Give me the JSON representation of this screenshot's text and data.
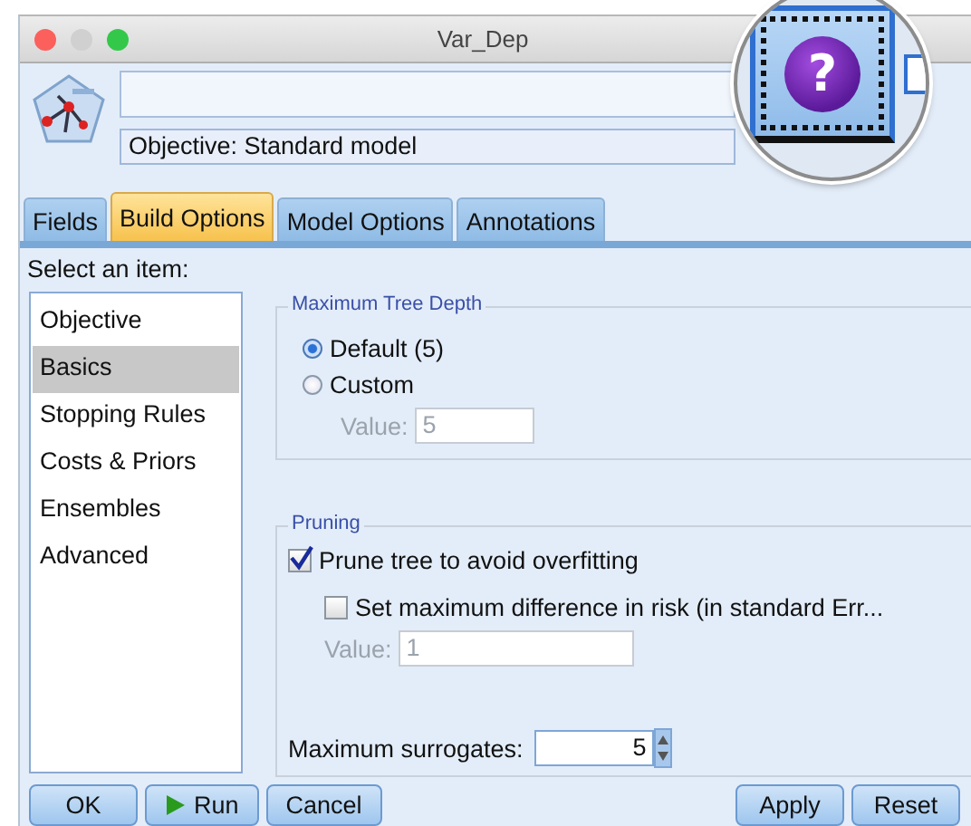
{
  "window": {
    "title": "Var_Dep"
  },
  "header": {
    "objective": "Objective: Standard model",
    "help_glyph": "?"
  },
  "tabs": [
    {
      "label": "Fields",
      "selected": false
    },
    {
      "label": "Build Options",
      "selected": true
    },
    {
      "label": "Model Options",
      "selected": false
    },
    {
      "label": "Annotations",
      "selected": false
    }
  ],
  "item_list": {
    "label": "Select an item:",
    "items": [
      {
        "label": "Objective",
        "selected": false
      },
      {
        "label": "Basics",
        "selected": true
      },
      {
        "label": "Stopping Rules",
        "selected": false
      },
      {
        "label": "Costs & Priors",
        "selected": false
      },
      {
        "label": "Ensembles",
        "selected": false
      },
      {
        "label": "Advanced",
        "selected": false
      }
    ]
  },
  "tree_depth": {
    "title": "Maximum Tree Depth",
    "options": [
      {
        "label": "Default (5)",
        "selected": true
      },
      {
        "label": "Custom",
        "selected": false
      }
    ],
    "value_label": "Value:",
    "value": "5",
    "disabled": true
  },
  "pruning": {
    "title": "Pruning",
    "prune": {
      "label": "Prune tree to avoid overfitting",
      "checked": true
    },
    "max_difference": {
      "label": "Set maximum difference in risk (in standard Err...",
      "checked": false
    },
    "value_label": "Value:",
    "value": "1",
    "disabled": true
  },
  "surrogates": {
    "label": "Maximum surrogates:",
    "value": "5"
  },
  "buttons": [
    {
      "label": "OK",
      "kind": "plain"
    },
    {
      "label": "Run",
      "kind": "run"
    },
    {
      "label": "Cancel",
      "kind": "plain"
    }
  ],
  "right_buttons": [
    {
      "label": "Apply"
    },
    {
      "label": "Reset"
    }
  ]
}
